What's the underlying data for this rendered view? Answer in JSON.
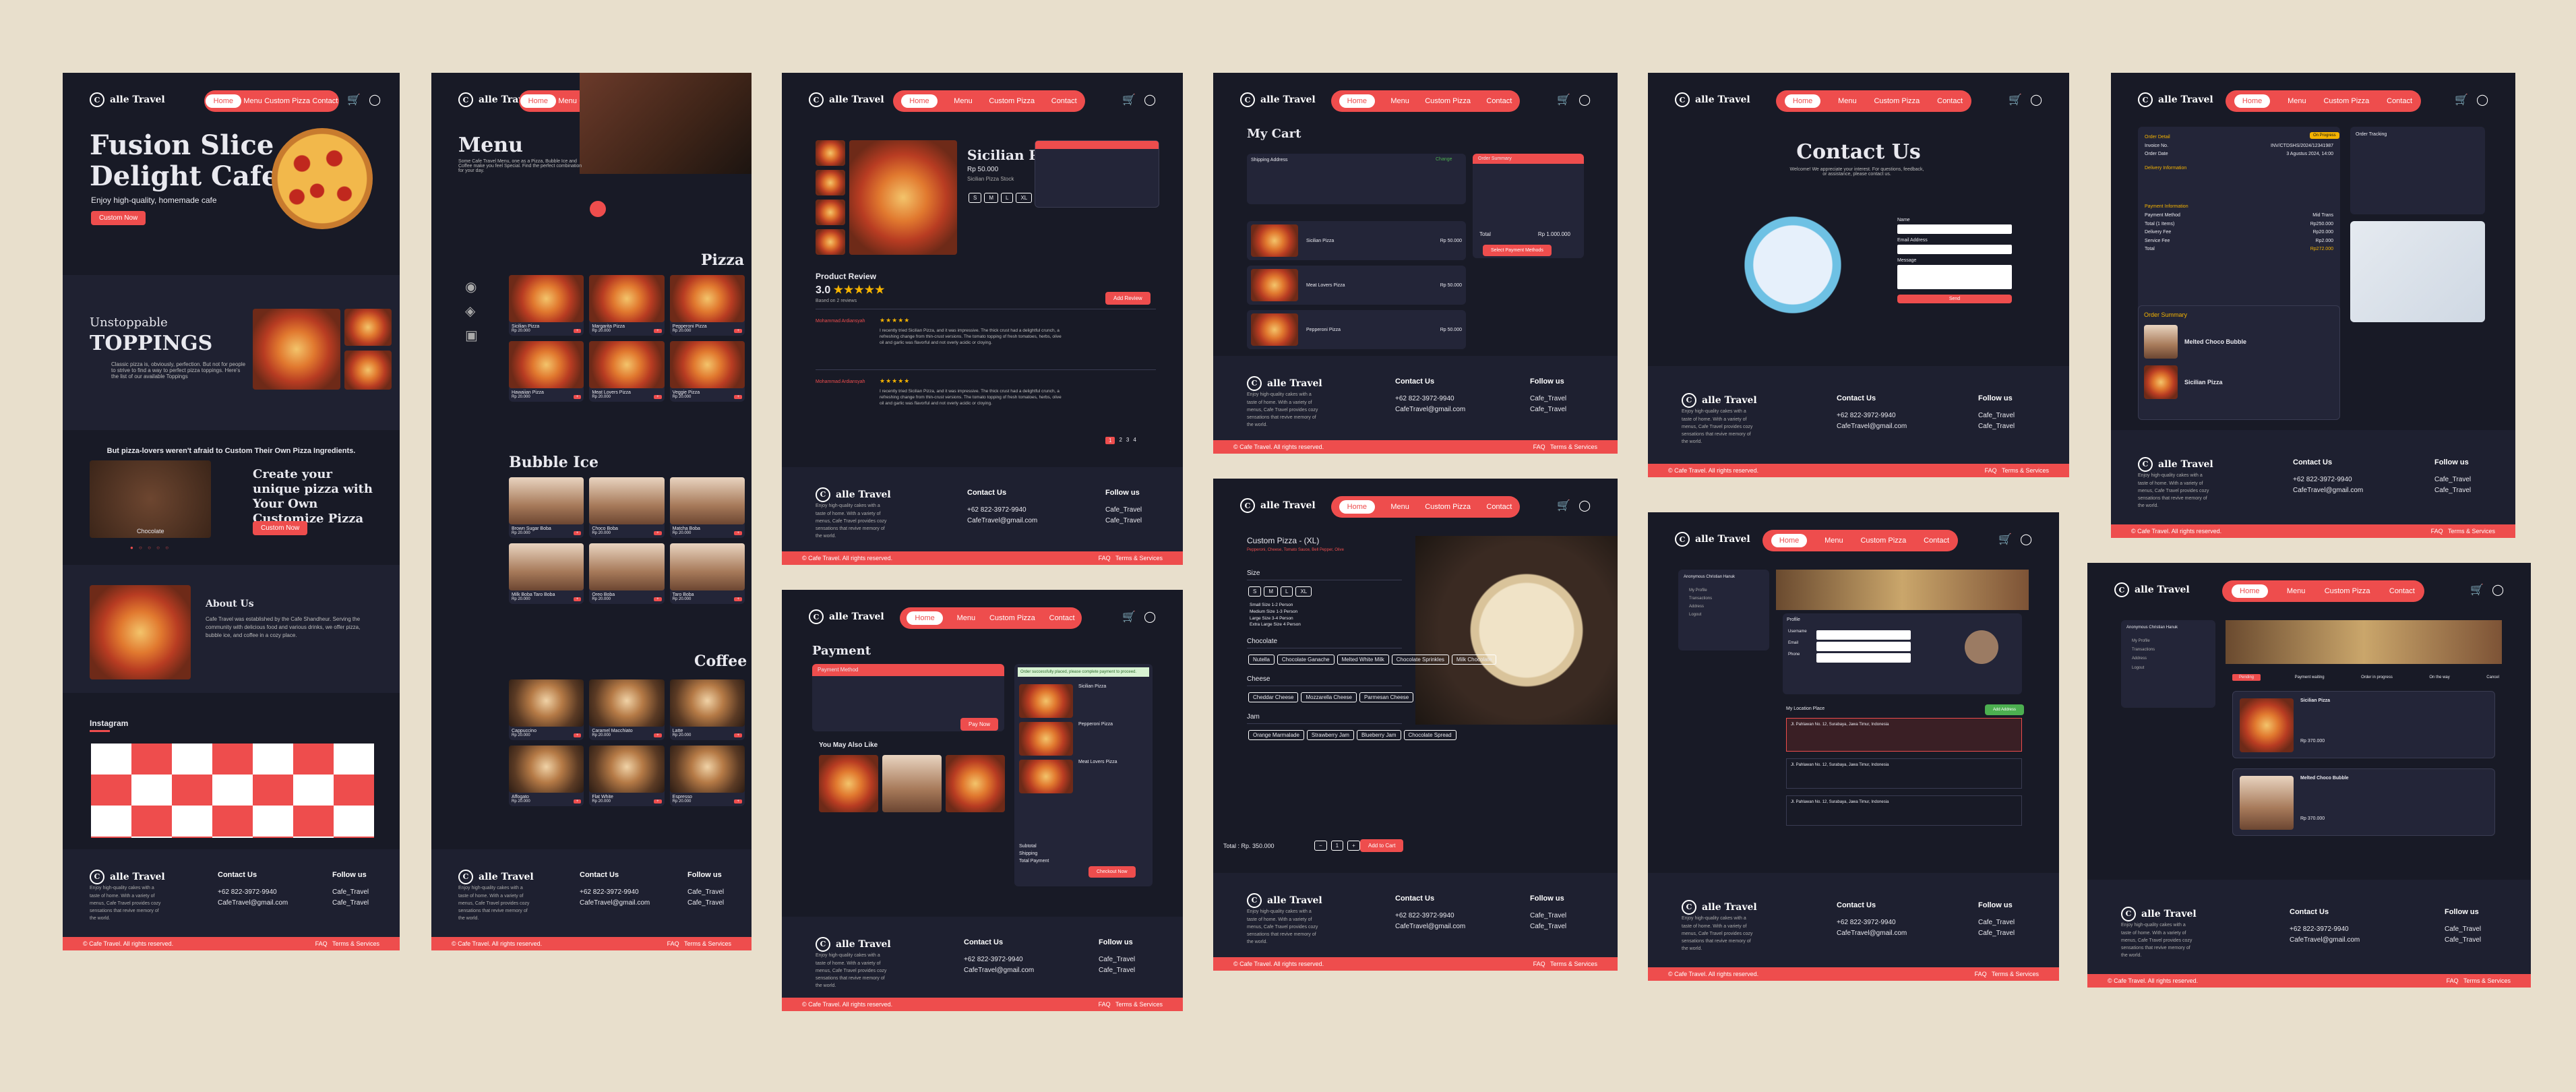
{
  "brand": "alle Travel",
  "nav": [
    "Home",
    "Menu",
    "Custom Pizza",
    "Contact"
  ],
  "accent": "#ee4d4d",
  "home": {
    "title1": "Fusion Slice",
    "title2": "Delight Cafe",
    "tagline": "Enjoy high-quality, homemade cafe",
    "cta": "Custom Now",
    "unstoppable": "Unstoppable",
    "toppings": "TOPPINGS",
    "toppings_desc": "Classic pizza is, obviously, perfection. But not for people to strive to find a way to perfect pizza toppings. Here's the list of our available Toppings",
    "custom_banner": "But pizza-lovers weren't afraid to Custom Their Own Pizza Ingredients.",
    "custom_title": "Create your unique pizza with Your Own Customize Pizza",
    "custom_btn": "Custom Now",
    "chocolate": "Chocolate",
    "about_title": "About Us",
    "about_text": "Cafe Travel was established by the Cafe Shandheur. Serving the community with delicious food and various drinks, we offer pizza, bubble ice, and coffee in a cozy place.",
    "instagram": "Instagram"
  },
  "footer": {
    "brand_desc": "Enjoy high-quality cakes with a taste of home. With a variety of menus, Cafe Travel provides cozy sensations that revive memory of the world.",
    "contact_title": "Contact Us",
    "phone": "+62 822-3972-9940",
    "email": "CafeTravel@gmail.com",
    "follow_title": "Follow us",
    "social1": "Cafe_Travel",
    "social2": "Cafe_Travel",
    "copyright": "© Cafe Travel. All rights reserved.",
    "faq": "FAQ",
    "terms": "Terms & Services"
  },
  "menu": {
    "title": "Menu",
    "desc": "Some Cafe Travel Menu, one as a Pizza, Bubble Ice and Coffee make you feel Special. Find the perfect combination for your day.",
    "pizza": "Pizza",
    "bubble": "Bubble Ice",
    "coffee": "Coffee",
    "pizzas": [
      "Sicilian Pizza",
      "Margarita Pizza",
      "Pepperoni Pizza",
      "Hawaiian Pizza",
      "Meat Lovers Pizza",
      "Veggie Pizza"
    ],
    "bubbles": [
      "Brown Sugar Boba",
      "Choco Boba",
      "Matcha Boba",
      "Milk Boba Taro Boba",
      "Oreo Boba",
      "Taro Boba"
    ],
    "coffees": [
      "Cappuccino",
      "Caramel Macchiato",
      "Latte",
      "Affogato",
      "Flat White",
      "Espresso"
    ],
    "price": "Rp 20.000",
    "add": "+"
  },
  "detail": {
    "name": "Sicilian Pizza",
    "price": "Rp 50.000",
    "stock": "Sicilian Pizza Stock",
    "review_title": "Product Review",
    "rating": "3.0",
    "reviews_count": "Based on 2 reviews",
    "add_review": "Add Review",
    "reviewer1": "Mohammad Ardiansyah",
    "reviewer2": "Mohammad Ardiansyah",
    "review_text": "I recently tried Sicilian Pizza, and it was impressive. The thick crust had a delightful crunch, a refreshing change from thin-crust versions. The tomato topping of fresh tomatoes, herbs, olive oil and garlic was flavorful and not overly acidic or cloying.",
    "pages": [
      "1",
      "2",
      "3",
      "4"
    ]
  },
  "payment": {
    "title": "Payment",
    "method": "Payment Method",
    "confirm": "Pay Now",
    "also": "You May Also Like",
    "success": "Order successfully placed, please complete payment to proceed.",
    "items": [
      "Sicilian Pizza",
      "Pepperoni Pizza",
      "Meat Lovers Pizza"
    ],
    "subtotal": "Subtotal",
    "shipping": "Shipping",
    "total": "Total Payment",
    "checkout": "Checkout Now"
  },
  "cart": {
    "title": "My Cart",
    "address": "Shipping Address",
    "change": "Change",
    "items": [
      "Sicilian Pizza",
      "Meat Lovers Pizza",
      "Pepperoni Pizza"
    ],
    "summary": "Order Summary",
    "total": "Total",
    "total_val": "Rp 1.000.000",
    "btn": "Select Payment Methods",
    "price": "Rp 50.000"
  },
  "custom": {
    "title": "Custom Pizza - (XL)",
    "sub": "Pepperoni, Cheese, Tomato Sauce, Bell Pepper, Olive",
    "size": "Size",
    "sizes": [
      "S",
      "M",
      "L",
      "XL"
    ],
    "size_list": [
      "Small Size 1-2 Person",
      "Medium Size 1-3 Person",
      "Large Size 3-4 Person",
      "Extra Large Size 4 Person"
    ],
    "chocolate": "Chocolate",
    "chocs": [
      "Nutella",
      "Chocolate Ganache",
      "Melted White Milk",
      "Chocolate Sprinkles",
      "Milk Chocolate"
    ],
    "cheese": "Cheese",
    "cheeses": [
      "Cheddar Cheese",
      "Mozzarella Cheese",
      "Parmesan Cheese"
    ],
    "jam": "Jam",
    "jams": [
      "Orange Marmalade",
      "Strawberry Jam",
      "Blueberry Jam",
      "Chocolate Spread"
    ],
    "total": "Total : Rp. 350.000",
    "qty": "1",
    "btn": "Add to Cart"
  },
  "contact": {
    "title": "Contact Us",
    "desc": "Welcome! We appreciate your interest. For questions, feedback, or assistance, please contact us.",
    "name": "Name",
    "email": "Email Address",
    "message": "Message",
    "send": "Send"
  },
  "profile": {
    "user": "Anonymous Christian Hanuk",
    "menu": [
      "My Profile",
      "Transactions",
      "Address",
      "Logout"
    ],
    "profile": "Profile",
    "labels": [
      "Username",
      "Email",
      "Phone"
    ],
    "save": "Save",
    "location": "My Location Place",
    "add_addr": "Add Address",
    "addr_text": "Jl. Pahlawan No. 12, Surabaya, Jawa Timur, Indonesia"
  },
  "order": {
    "detail": "Order Detail",
    "status": "On Progress",
    "invoice": "Invoice No.",
    "invoice_val": "INV/CTDSHS/2024/12341987",
    "date": "Order Date",
    "date_val": "3 Agustus 2024, 14:00",
    "delivery": "Delivery Information",
    "payment": "Payment Information",
    "pay_rows": [
      "Payment Method",
      "Total (1 Items)",
      "Delivery Fee",
      "Service Fee",
      "Total"
    ],
    "pay_vals": [
      "Mid Trans",
      "Rp250.000",
      "Rp20.000",
      "Rp2.000",
      "Rp272.000"
    ],
    "tracking": "Order Tracking",
    "summary": "Order Summary",
    "items": [
      "Melted Choco Bubble",
      "Sicilian Pizza"
    ]
  },
  "transactions": {
    "tabs": [
      "Pending",
      "Payment waiting",
      "Order in progress",
      "On the way",
      "Cancel"
    ],
    "items": [
      "Sicilian Pizza",
      "Melted Choco Bubble"
    ],
    "price": "Rp 370.000"
  }
}
